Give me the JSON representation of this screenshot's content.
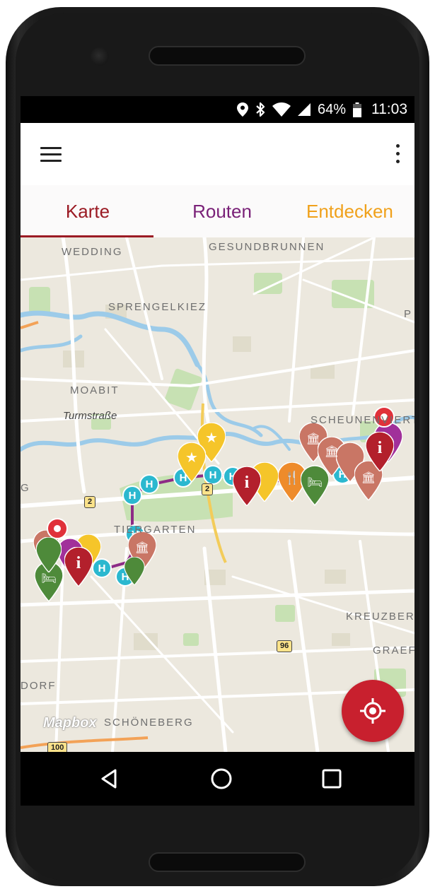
{
  "status_bar": {
    "battery_percent": "64%",
    "time": "11:03",
    "icons": [
      "location-icon",
      "bluetooth-icon",
      "wifi-icon",
      "signal-icon",
      "battery-icon"
    ]
  },
  "app_bar": {
    "menu_icon": "menu-icon",
    "more_icon": "more-vert-icon"
  },
  "tabs": [
    {
      "label": "Karte",
      "active": true,
      "color": "#9b1b24"
    },
    {
      "label": "Routen",
      "active": false,
      "color": "#7a2178"
    },
    {
      "label": "Entdecken",
      "active": false,
      "color": "#f0a11b"
    }
  ],
  "map": {
    "labels": {
      "wedding": "WEDDING",
      "gesundbrunnen": "GESUNDBRUNNEN",
      "sprengelkiez": "SPRENGELKIEZ",
      "p": "P",
      "moabit": "MOABIT",
      "turmstrasse": "Turmstraße",
      "scheunenviertel": "SCHEUNENVIERTEL",
      "g": "G",
      "tiergarten": "TIERGARTEN",
      "kreuzberg": "KREUZBER",
      "graefe": "GRAEFE",
      "dorf": "DORF",
      "schoeneberg": "SCHÖNEBERG"
    },
    "road_shields": [
      "2",
      "2",
      "96",
      "100"
    ],
    "attribution": "Mapbox",
    "colors": {
      "water": "#8fc3e6",
      "park": "#b9d9a4",
      "route": "#8d2b86",
      "poi_red": "#b3202c",
      "poi_brown": "#c97665",
      "poi_green": "#4e8a3a",
      "poi_cyan": "#2bb8cf",
      "poi_yellow": "#f5c52a",
      "poi_orange": "#ee8b2b",
      "poi_purple": "#8d2b86"
    }
  },
  "fab": {
    "icon": "my-location-icon",
    "color": "#c8202e"
  },
  "nav_bar": {
    "icons": [
      "back-icon",
      "home-icon",
      "recents-icon"
    ]
  }
}
